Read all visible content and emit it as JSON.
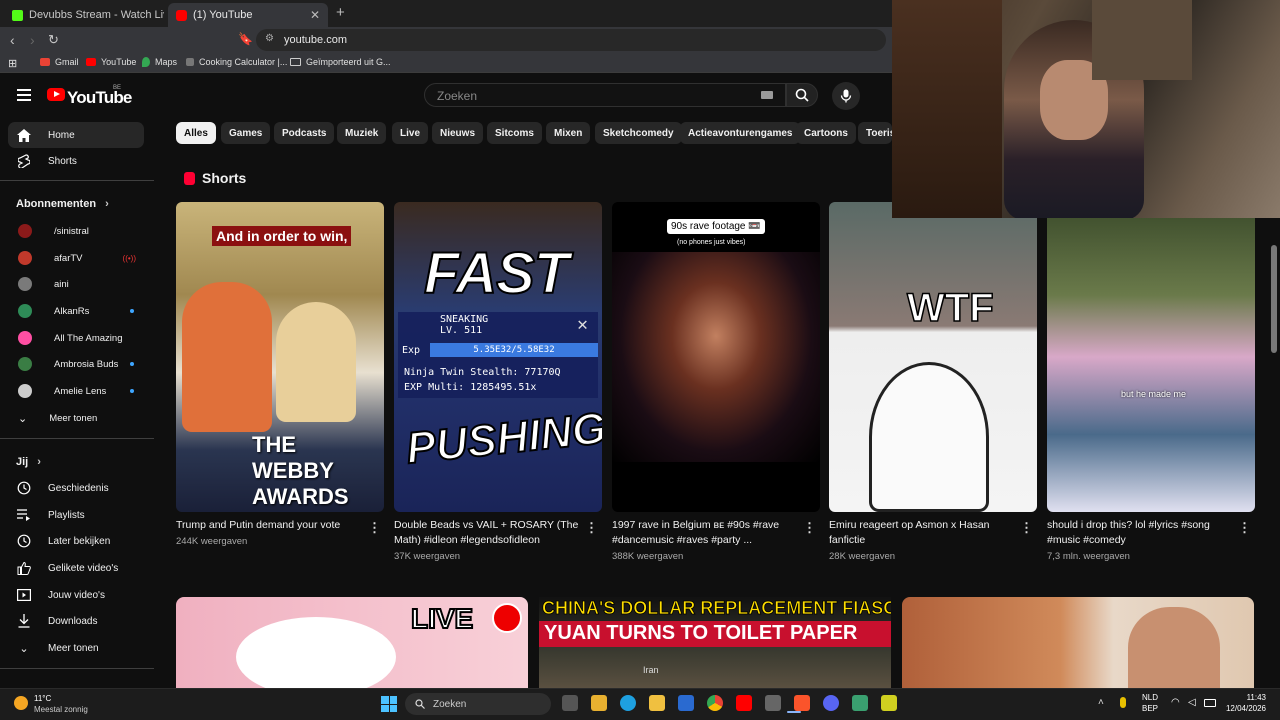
{
  "tabs": [
    {
      "title": "Devubbs Stream - Watch Live on"
    },
    {
      "title": "(1) YouTube"
    }
  ],
  "url": "youtube.com",
  "bookmarks": [
    "Gmail",
    "YouTube",
    "Maps",
    "Cooking Calculator |...",
    "Geïmporteerd uit G..."
  ],
  "header": {
    "logo": "YouTube",
    "region": "BE",
    "search_placeholder": "Zoeken"
  },
  "sidebar": {
    "main": [
      {
        "label": "Home",
        "icon": "home-icon"
      },
      {
        "label": "Shorts",
        "icon": "shorts-icon"
      }
    ],
    "subscriptions_title": "Abonnementen",
    "subscriptions": [
      {
        "label": "/sinistral",
        "color": "#8b1a1a",
        "indicator": ""
      },
      {
        "label": "afarTV",
        "color": "#c0392b",
        "indicator": "live"
      },
      {
        "label": "aini",
        "color": "#7a7a7a",
        "indicator": ""
      },
      {
        "label": "AlkanRs",
        "color": "#2e8b57",
        "indicator": "dot"
      },
      {
        "label": "All The Amazing",
        "color": "#ff4fa3",
        "indicator": ""
      },
      {
        "label": "Ambrosia Buds",
        "color": "#3a7d44",
        "indicator": "dot"
      },
      {
        "label": "Amelie Lens",
        "color": "#cccccc",
        "indicator": "dot"
      }
    ],
    "more_1": "Meer tonen",
    "you_title": "Jij",
    "you": [
      {
        "label": "Geschiedenis",
        "icon": "history-icon"
      },
      {
        "label": "Playlists",
        "icon": "playlists-icon"
      },
      {
        "label": "Later bekijken",
        "icon": "watch-later-icon"
      },
      {
        "label": "Gelikete video's",
        "icon": "liked-icon"
      },
      {
        "label": "Jouw video's",
        "icon": "your-videos-icon"
      },
      {
        "label": "Downloads",
        "icon": "download-icon"
      }
    ],
    "more_2": "Meer tonen"
  },
  "chips": [
    "Alles",
    "Games",
    "Podcasts",
    "Muziek",
    "Live",
    "Nieuws",
    "Sitcoms",
    "Mixen",
    "Sketchcomedy",
    "Actieavonturengames",
    "Cartoons",
    "Toeris"
  ],
  "shorts_title": "Shorts",
  "shorts": [
    {
      "title": "Trump and Putin demand your vote",
      "views": "244K weergaven",
      "overlay": "And in order to win,",
      "overlay2": "THE WEBBY AWARDS"
    },
    {
      "title": "Double Beads vs VAIL + ROSARY (The Math) #idleon #legendsofidleon",
      "views": "37K weergaven",
      "overlay": "FAST",
      "overlay2": "PUSHING",
      "game1": "SNEAKING",
      "game2": "LV. 511",
      "game3": "Exp",
      "game4": "5.35E32/5.58E32",
      "game5": "Ninja Twin Stealth: 77170Q",
      "game6": "EXP Multi: 1285495.51x"
    },
    {
      "title": "1997 rave in Belgium ʙᴇ #90s #rave #dancemusic #raves #party ...",
      "views": "388K weergaven",
      "overlay": "90s rave footage 📼",
      "overlay2": "(no phones just vibes)"
    },
    {
      "title": "Emiru reageert op Asmon x Hasan fanfictie",
      "views": "28K weergaven",
      "overlay": "WTF"
    },
    {
      "title": "should i drop this? lol #lyrics #song #music #comedy",
      "views": "7,3 mln. weergaven",
      "overlay": "but he made me"
    }
  ],
  "videos": [
    {
      "overlay": "LIVE"
    },
    {
      "overlay": "CHINA'S DOLLAR REPLACEMENT FIASCO",
      "overlay2": "YUAN TURNS TO TOILET PAPER",
      "overlay3": "Iran"
    },
    {
      "overlay": ""
    }
  ],
  "taskbar": {
    "weather_temp": "11°C",
    "weather_desc": "Meestal zonnig",
    "search": "Zoeken",
    "lang": "NLD",
    "lang2": "BEP",
    "time": "11:43",
    "date": "12/04/2026"
  }
}
